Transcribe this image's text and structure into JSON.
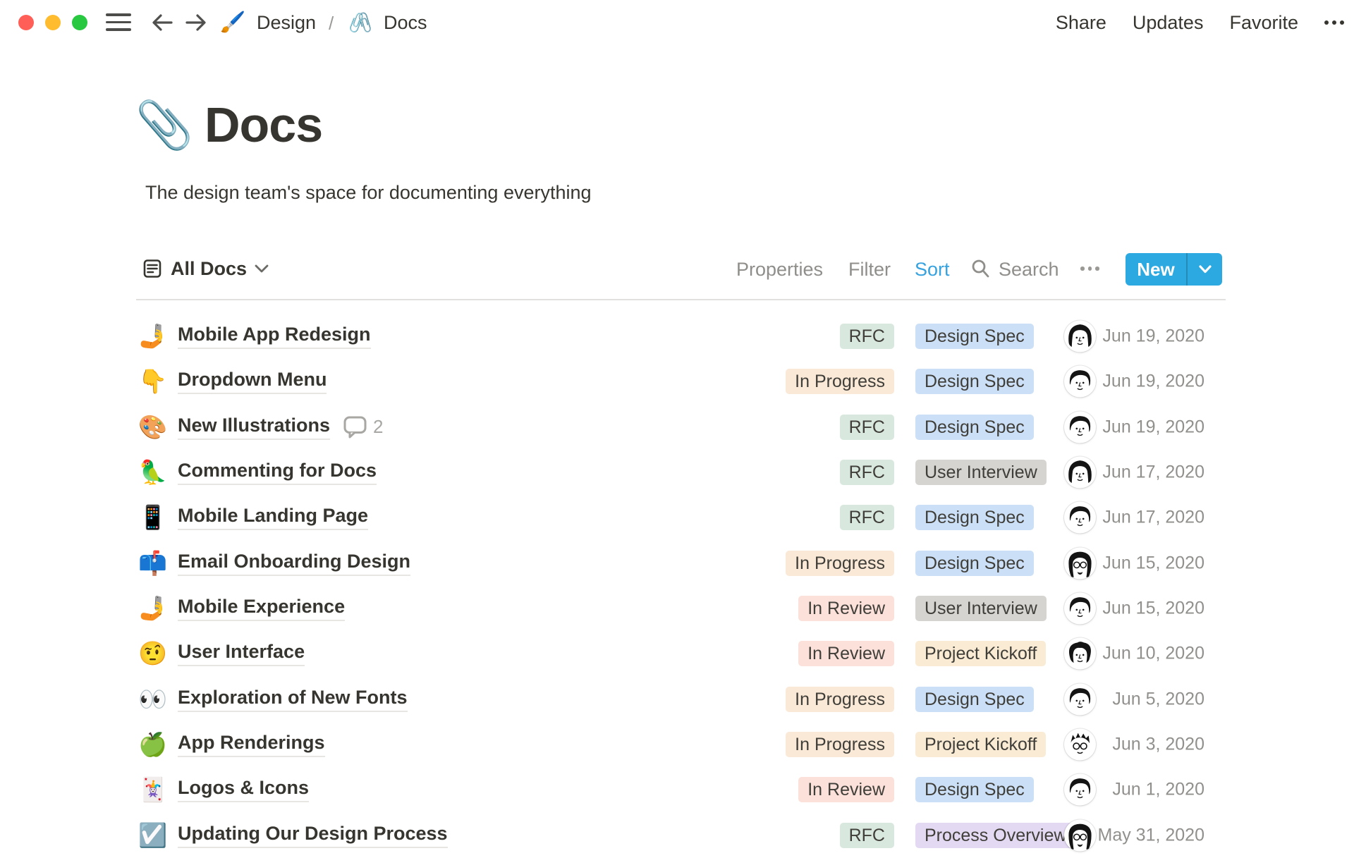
{
  "topbar": {
    "breadcrumb": [
      {
        "icon": "🖌️",
        "label": "Design"
      },
      {
        "icon": "🖇️",
        "label": "Docs"
      }
    ],
    "separator": "/",
    "share": "Share",
    "updates": "Updates",
    "favorite": "Favorite"
  },
  "page": {
    "icon": "📎",
    "title": "Docs",
    "subtitle": "The design team's space for documenting everything"
  },
  "toolbar": {
    "view_label": "All Docs",
    "properties": "Properties",
    "filter": "Filter",
    "sort": "Sort",
    "search": "Search",
    "new_label": "New"
  },
  "colors": {
    "new_button_blue": "#2CA9E1",
    "sort_active_blue": "#36A2DF",
    "traffic_red": "#FF5F57",
    "traffic_yellow": "#FEBC2E",
    "traffic_green": "#28C840",
    "title_underline": "#E7E6E3",
    "date_gray": "#91908D"
  },
  "tag_colors": {
    "green": "#D8E8DF",
    "orange": "#FAE9D7",
    "red": "#FCE1DA",
    "blue": "#CBE0F7",
    "gray": "#D5D4D1",
    "yellow": "#FAEBD4",
    "purple": "#E3D9F3"
  },
  "rows": [
    {
      "icon": "🤳",
      "title": "Mobile App Redesign",
      "comments": null,
      "status": "RFC",
      "status_color": "green",
      "type": "Design Spec",
      "type_color": "blue",
      "avatar": "woman-bob",
      "date": "Jun 19, 2020"
    },
    {
      "icon": "👇",
      "title": "Dropdown Menu",
      "comments": null,
      "status": "In Progress",
      "status_color": "orange",
      "type": "Design Spec",
      "type_color": "blue",
      "avatar": "man-1",
      "date": "Jun 19, 2020"
    },
    {
      "icon": "🎨",
      "title": "New Illustrations",
      "comments": "2",
      "status": "RFC",
      "status_color": "green",
      "type": "Design Spec",
      "type_color": "blue",
      "avatar": "man-1",
      "date": "Jun 19, 2020"
    },
    {
      "icon": "🦜",
      "title": "Commenting for Docs",
      "comments": null,
      "status": "RFC",
      "status_color": "green",
      "type": "User Interview",
      "type_color": "gray",
      "avatar": "woman-bob",
      "date": "Jun 17, 2020"
    },
    {
      "icon": "📱",
      "title": "Mobile Landing Page",
      "comments": null,
      "status": "RFC",
      "status_color": "green",
      "type": "Design Spec",
      "type_color": "blue",
      "avatar": "man-1",
      "date": "Jun 17, 2020"
    },
    {
      "icon": "📫",
      "title": "Email Onboarding Design",
      "comments": null,
      "status": "In Progress",
      "status_color": "orange",
      "type": "Design Spec",
      "type_color": "blue",
      "avatar": "person-glasses",
      "date": "Jun 15, 2020"
    },
    {
      "icon": "🤳",
      "title": "Mobile Experience",
      "comments": null,
      "status": "In Review",
      "status_color": "red",
      "type": "User Interview",
      "type_color": "gray",
      "avatar": "man-1",
      "date": "Jun 15, 2020"
    },
    {
      "icon": "🤨",
      "title": "User Interface",
      "comments": null,
      "status": "In Review",
      "status_color": "red",
      "type": "Project Kickoff",
      "type_color": "yellow",
      "avatar": "woman-curly",
      "date": "Jun 10, 2020"
    },
    {
      "icon": "👀",
      "title": "Exploration of New Fonts",
      "comments": null,
      "status": "In Progress",
      "status_color": "orange",
      "type": "Design Spec",
      "type_color": "blue",
      "avatar": "man-1",
      "date": "Jun 5, 2020"
    },
    {
      "icon": "🍏",
      "title": "App Renderings",
      "comments": null,
      "status": "In Progress",
      "status_color": "orange",
      "type": "Project Kickoff",
      "type_color": "yellow",
      "avatar": "man-spiky",
      "date": "Jun 3, 2020"
    },
    {
      "icon": "🃏",
      "title": "Logos & Icons",
      "comments": null,
      "status": "In Review",
      "status_color": "red",
      "type": "Design Spec",
      "type_color": "blue",
      "avatar": "man-1",
      "date": "Jun 1, 2020"
    },
    {
      "icon": "☑️",
      "title": "Updating Our Design Process",
      "comments": null,
      "status": "RFC",
      "status_color": "green",
      "type": "Process Overview",
      "type_color": "purple",
      "avatar": "person-glasses",
      "date": "May 31, 2020"
    }
  ]
}
